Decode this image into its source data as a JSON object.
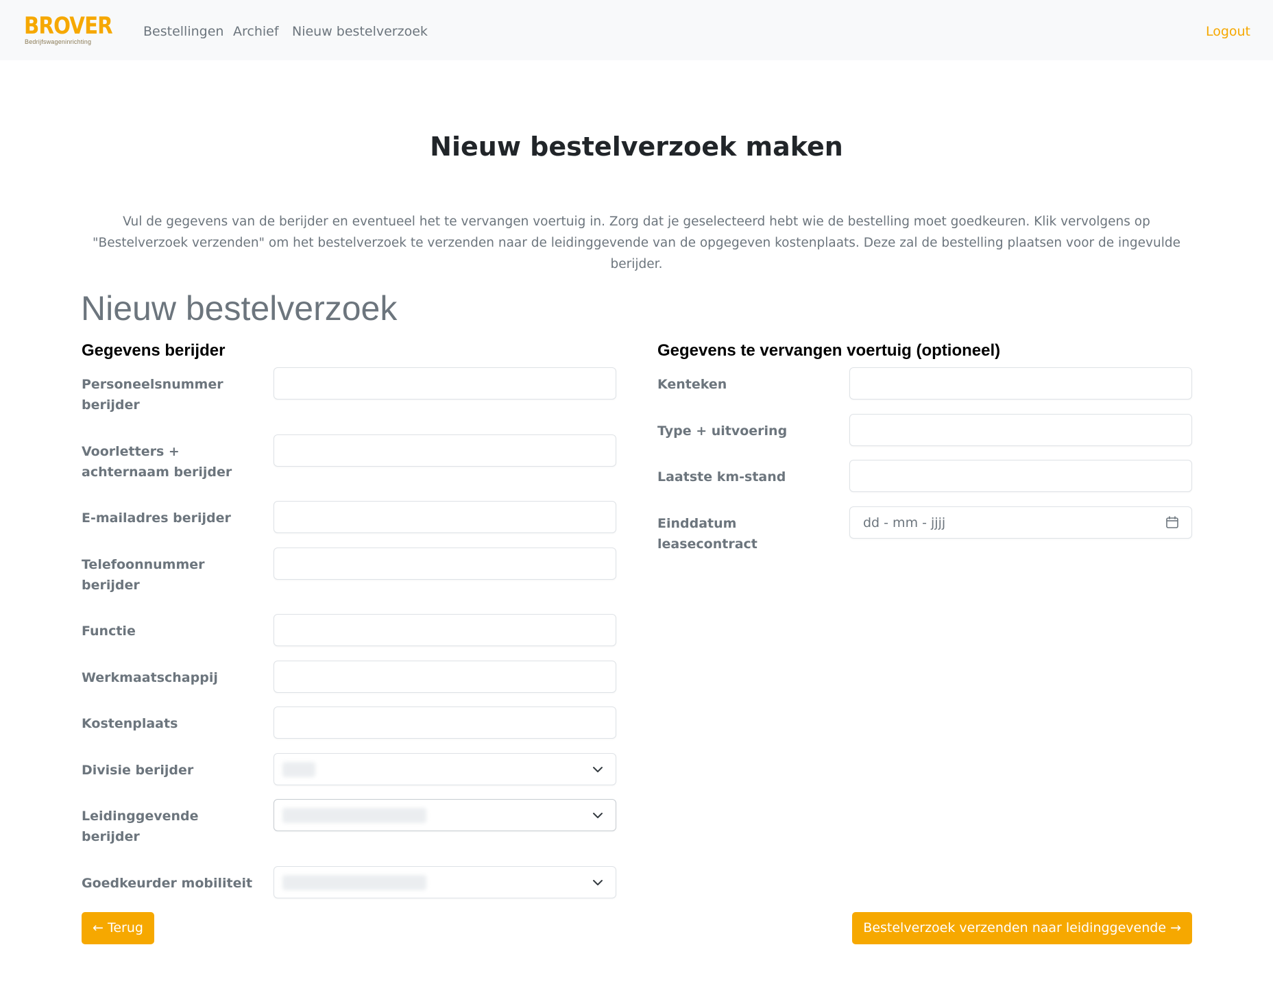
{
  "brand": {
    "name": "BROVER",
    "tagline": "Bedrijfswageninrichting",
    "color": "#f6a800"
  },
  "nav": {
    "items": [
      "Bestellingen",
      "Archief",
      "Nieuw bestelverzoek"
    ],
    "logout": "Logout"
  },
  "page": {
    "title": "Nieuw bestelverzoek maken",
    "intro": "Vul de gegevens van de berijder en eventueel het te vervangen voertuig in. Zorg dat je geselecteerd hebt wie de bestelling moet goedkeuren. Klik vervolgens op \"Bestelverzoek verzenden\" om het bestelverzoek te verzenden naar de leidinggevende van de opgegeven kostenplaats. Deze zal de bestelling plaatsen voor de ingevulde berijder."
  },
  "form": {
    "title": "Nieuw bestelverzoek",
    "driver_section": {
      "title": "Gegevens berijder",
      "fields": [
        {
          "label": "Personeelsnummer berijder",
          "value": ""
        },
        {
          "label": "Voorletters + achternaam berijder",
          "value": ""
        },
        {
          "label": "E-mailadres berijder",
          "value": ""
        },
        {
          "label": "Telefoonnummer berijder",
          "value": ""
        },
        {
          "label": "Functie",
          "value": ""
        },
        {
          "label": "Werkmaatschappij",
          "value": ""
        },
        {
          "label": "Kostenplaats",
          "value": ""
        },
        {
          "label": "Divisie berijder",
          "value": ""
        },
        {
          "label": "Leidinggevende berijder",
          "value": ""
        },
        {
          "label": "Goedkeurder mobiliteit",
          "value": ""
        }
      ]
    },
    "vehicle_section": {
      "title": "Gegevens te vervangen voertuig (optioneel)",
      "fields": [
        {
          "label": "Kenteken",
          "value": ""
        },
        {
          "label": "Type + uitvoering",
          "value": ""
        },
        {
          "label": "Laatste km-stand",
          "value": ""
        },
        {
          "label": "Einddatum leasecontract",
          "placeholder": "dd - mm - jjjj"
        }
      ]
    },
    "back_button": "← Terug",
    "submit_button": "Bestelverzoek verzenden naar leidinggevende →"
  }
}
